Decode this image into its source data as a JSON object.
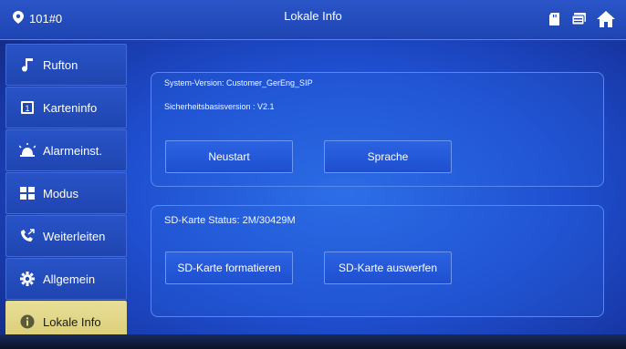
{
  "header": {
    "location": "101#0",
    "title": "Lokale Info",
    "icons": [
      "sd-card-icon",
      "message-icon",
      "home-icon"
    ]
  },
  "sidebar": {
    "items": [
      {
        "label": "Rufton",
        "icon": "music-note-icon",
        "active": false
      },
      {
        "label": "Karteninfo",
        "icon": "card-icon",
        "active": false
      },
      {
        "label": "Alarmeinst.",
        "icon": "alarm-icon",
        "active": false
      },
      {
        "label": "Modus",
        "icon": "grid-icon",
        "active": false
      },
      {
        "label": "Weiterleiten",
        "icon": "call-forward-icon",
        "active": false
      },
      {
        "label": "Allgemein",
        "icon": "gear-icon",
        "active": false
      },
      {
        "label": "Lokale Info",
        "icon": "info-icon",
        "active": true
      }
    ]
  },
  "system": {
    "version": "System-Version: Customer_GerEng_SIP",
    "security": "Sicherheitsbasisversion : V2.1",
    "restart_label": "Neustart",
    "language_label": "Sprache"
  },
  "sd": {
    "status": "SD-Karte Status: 2M/30429M",
    "format_label": "SD-Karte formatieren",
    "eject_label": "SD-Karte auswerfen"
  },
  "colors": {
    "background": "#1f4fd0",
    "active_item": "#e3d886",
    "button": "#2559d8"
  }
}
